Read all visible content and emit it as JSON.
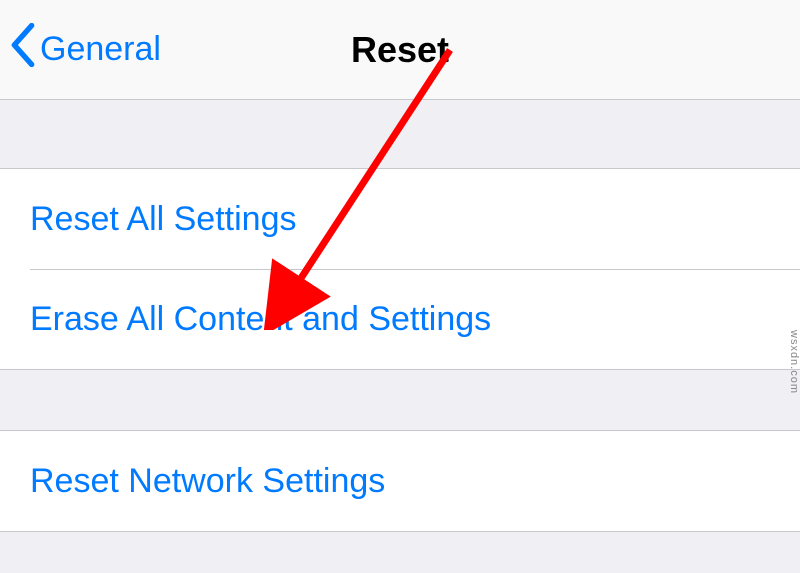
{
  "navbar": {
    "back_label": "General",
    "title": "Reset"
  },
  "group1": {
    "items": [
      {
        "label": "Reset All Settings"
      },
      {
        "label": "Erase All Content and Settings"
      }
    ]
  },
  "group2": {
    "items": [
      {
        "label": "Reset Network Settings"
      }
    ]
  },
  "watermark": "wsxdn.com",
  "colors": {
    "tint": "#007aff",
    "arrow": "#ff0000"
  }
}
